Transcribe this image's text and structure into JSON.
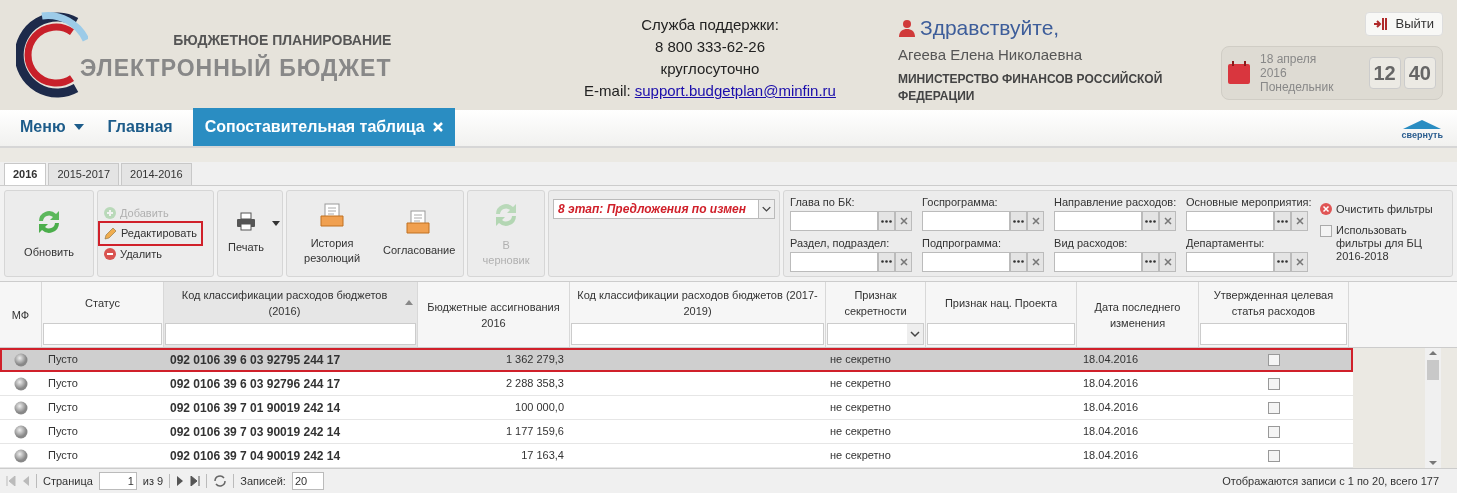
{
  "header": {
    "logo": {
      "line1": "БЮДЖЕТНОЕ ПЛАНИРОВАНИЕ",
      "line2": "ЭЛЕКТРОННЫЙ БЮДЖЕТ"
    },
    "support": {
      "title": "Служба поддержки:",
      "phone": "8 800 333-62-26",
      "hours": "круглосуточно",
      "email_label": "E-mail:",
      "email": "support.budgetplan@minfin.ru"
    },
    "user": {
      "greeting": "Здравствуйте,",
      "name": "Агеева Елена Николаевна",
      "org": "МИНИСТЕРСТВО ФИНАНСОВ РОССИЙСКОЙ ФЕДЕРАЦИИ"
    },
    "logout": "Выйти",
    "date": {
      "day": "18 апреля",
      "year": "2016",
      "weekday": "Понедельник"
    },
    "clock": {
      "hours": "12",
      "minutes": "40"
    }
  },
  "nav": {
    "items": [
      {
        "label": "Меню",
        "kind": "dropdown",
        "selected": false
      },
      {
        "label": "Главная",
        "kind": "link",
        "selected": false
      },
      {
        "label": "Сопоставительная таблица",
        "kind": "tab",
        "selected": true
      }
    ],
    "collapse": "свернуть"
  },
  "year_tabs": [
    {
      "label": "2016",
      "selected": true
    },
    {
      "label": "2015-2017",
      "selected": false
    },
    {
      "label": "2014-2016",
      "selected": false
    }
  ],
  "toolbar": {
    "groups": [
      [
        {
          "kind": "refresh",
          "label": "Обновить",
          "disabled": false,
          "highlighted": false
        }
      ],
      [
        {
          "kind": "add",
          "label": "Добавить",
          "disabled": true,
          "highlighted": false
        },
        {
          "kind": "edit",
          "label": "Редактировать",
          "disabled": false,
          "highlighted": true
        },
        {
          "kind": "delete",
          "label": "Удалить",
          "disabled": false,
          "highlighted": false
        }
      ],
      [
        {
          "kind": "print",
          "label": "Печать",
          "disabled": false,
          "highlighted": false
        }
      ],
      [
        {
          "kind": "history",
          "label": "История резолюций",
          "disabled": false,
          "highlighted": false
        },
        {
          "kind": "approval",
          "label": "Согласование",
          "disabled": false,
          "highlighted": false
        }
      ],
      [
        {
          "kind": "draft",
          "label": "В черновик",
          "disabled": true,
          "highlighted": false
        }
      ]
    ],
    "stage": "8 этап: Предложения по измен"
  },
  "filters": {
    "fields": [
      {
        "label": "Глава по БК:"
      },
      {
        "label": "Раздел, подраздел:"
      },
      {
        "label": "Госпрограмма:"
      },
      {
        "label": "Подпрограмма:"
      },
      {
        "label": "Направление расходов:"
      },
      {
        "label": "Вид расходов:"
      },
      {
        "label": "Основные мероприятия:"
      },
      {
        "label": "Департаменты:"
      }
    ],
    "clear": "Очистить фильтры",
    "use_filters": {
      "label": "Использовать фильтры для БЦ 2016-2018",
      "checked": false
    }
  },
  "table": {
    "columns": [
      {
        "label": "МФ",
        "kind": "plain",
        "sorted": false
      },
      {
        "label": "Статус",
        "kind": "text",
        "sorted": false
      },
      {
        "label": "Код классификации расходов бюджетов (2016)",
        "kind": "text",
        "sorted": true
      },
      {
        "label": "Бюджетные ассигнования 2016",
        "kind": "plain",
        "sorted": false
      },
      {
        "label": "Код классификации расходов бюджетов (2017-2019)",
        "kind": "text",
        "sorted": false
      },
      {
        "label": "Признак секретности",
        "kind": "select",
        "sorted": false
      },
      {
        "label": "Признак нац. Проекта",
        "kind": "text",
        "sorted": false
      },
      {
        "label": "Дата последнего изменения",
        "kind": "plain",
        "sorted": false
      },
      {
        "label": "Утвержденная целевая статья расходов",
        "kind": "text",
        "sorted": false
      }
    ],
    "rows": [
      {
        "status": "Пусто",
        "code": "092 0106 39 6 03 92795 244 17",
        "amount": "1 362 279,3",
        "secrecy": "не секретно",
        "date": "18.04.2016",
        "checked": false,
        "selected": true
      },
      {
        "status": "Пусто",
        "code": "092 0106 39 6 03 92796 244 17",
        "amount": "2 288 358,3",
        "secrecy": "не секретно",
        "date": "18.04.2016",
        "checked": false,
        "selected": false
      },
      {
        "status": "Пусто",
        "code": "092 0106 39 7 01 90019 242 14",
        "amount": "100 000,0",
        "secrecy": "не секретно",
        "date": "18.04.2016",
        "checked": false,
        "selected": false
      },
      {
        "status": "Пусто",
        "code": "092 0106 39 7 03 90019 242 14",
        "amount": "1 177 159,6",
        "secrecy": "не секретно",
        "date": "18.04.2016",
        "checked": false,
        "selected": false
      },
      {
        "status": "Пусто",
        "code": "092 0106 39 7 04 90019 242 14",
        "amount": "17 163,4",
        "secrecy": "не секретно",
        "date": "18.04.2016",
        "checked": false,
        "selected": false
      }
    ]
  },
  "pager": {
    "page_label": "Страница",
    "page": "1",
    "of": "из 9",
    "records_label": "Записей:",
    "records": "20",
    "summary": "Отображаются записи с 1 по 20, всего 177"
  }
}
